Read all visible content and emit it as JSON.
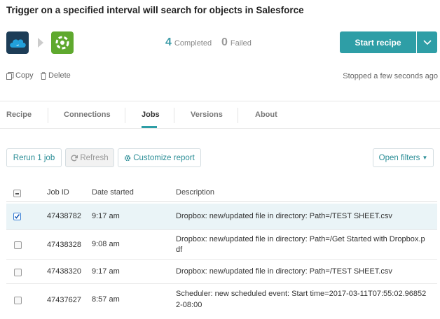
{
  "recipe": {
    "title": "Trigger on a specified interval will search for objects in Salesforce",
    "stats": {
      "completed_num": "4",
      "completed_label": "Completed",
      "failed_num": "0",
      "failed_label": "Failed"
    },
    "start_button": "Start recipe",
    "copy_label": "Copy",
    "delete_label": "Delete",
    "status": "Stopped a few seconds ago",
    "app_icons": [
      "salesforce-icon",
      "zendesk-icon"
    ]
  },
  "tabs": [
    {
      "label": "Recipe",
      "active": false
    },
    {
      "label": "Connections",
      "active": false
    },
    {
      "label": "Jobs",
      "active": true
    },
    {
      "label": "Versions",
      "active": false
    },
    {
      "label": "About",
      "active": false
    }
  ],
  "toolbar": {
    "rerun": "Rerun 1 job",
    "refresh": "Refresh",
    "customize": "Customize report",
    "filters": "Open filters"
  },
  "table": {
    "columns": [
      "Job ID",
      "Date started",
      "Description"
    ],
    "rows": [
      {
        "job_id": "47438782",
        "date": "9:17 am",
        "desc1": "Dropbox: new/updated file in directory: Path=/TEST SHEET.csv",
        "desc2": "",
        "checked": true
      },
      {
        "job_id": "47438328",
        "date": "9:08 am",
        "desc1": "Dropbox: new/updated file in directory: Path=/Get Started with Dropbox.p",
        "desc2": "df",
        "checked": false
      },
      {
        "job_id": "47438320",
        "date": "9:17 am",
        "desc1": "Dropbox: new/updated file in directory: Path=/TEST SHEET.csv",
        "desc2": "",
        "checked": false
      },
      {
        "job_id": "47437627",
        "date": "8:57 am",
        "desc1": "Scheduler: new scheduled event: Start time=2017-03-11T07:55:02.96852",
        "desc2": "2-08:00",
        "checked": false
      }
    ]
  },
  "colors": {
    "accent": "#2e9ea6",
    "selected_row": "#eaf4f7"
  }
}
